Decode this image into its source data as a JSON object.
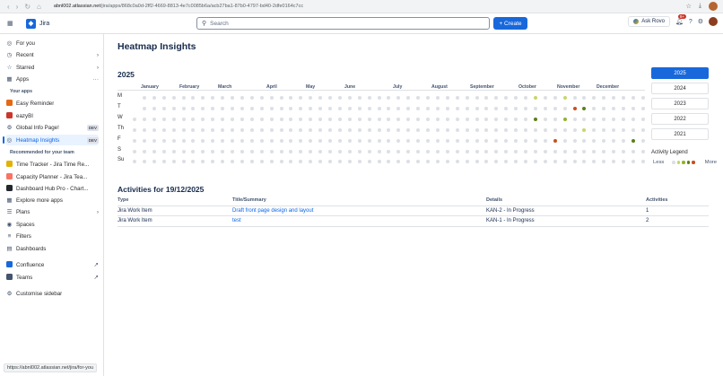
{
  "browser": {
    "nav_icons": [
      "back-icon",
      "forward-icon",
      "reload-icon",
      "home-icon"
    ],
    "url_domain": "abnl002.atlassian.net",
    "url_path": "/jira/apps/868c0a0d-2ff2-4669-8813-4e7c0085b6a/acb27ba1-87b0-4797-bd40-2dfe0164c7cc",
    "status_url": "https://abnl002.atlassian.net/jira/for-you"
  },
  "topnav": {
    "brand": "Jira",
    "search_placeholder": "Search",
    "create_label": "+ Create",
    "ask_rovo": "Ask Rovo",
    "notif_badge": "9+"
  },
  "sidebar": {
    "items": [
      {
        "label": "For you",
        "icon": "person-icon"
      },
      {
        "label": "Recent",
        "icon": "clock-icon"
      },
      {
        "label": "Starred",
        "icon": "star-icon"
      },
      {
        "label": "Apps",
        "icon": "apps-icon"
      }
    ],
    "your_apps_heading": "Your apps",
    "apps": [
      {
        "label": "Easy Reminder"
      },
      {
        "label": "eazyBI"
      },
      {
        "label": "Global Info Page!",
        "badge": "DEV"
      },
      {
        "label": "Heatmap Insights",
        "badge": "DEV"
      }
    ],
    "recommended_heading": "Recommended for your team",
    "recommended": [
      {
        "label": "Time Tracker - Jira Time Re..."
      },
      {
        "label": "Capacity Planner - Jira Tea..."
      },
      {
        "label": "Dashboard Hub Pro - Chart..."
      },
      {
        "label": "Explore more apps"
      }
    ],
    "bottom": [
      {
        "label": "Plans"
      },
      {
        "label": "Spaces"
      },
      {
        "label": "Filters"
      },
      {
        "label": "Dashboards"
      },
      {
        "label": "Confluence"
      },
      {
        "label": "Teams"
      },
      {
        "label": "Customise sidebar"
      }
    ]
  },
  "page": {
    "title": "Heatmap Insights",
    "year": "2025",
    "months": [
      "January",
      "February",
      "March",
      "April",
      "May",
      "June",
      "July",
      "August",
      "September",
      "October",
      "November",
      "December"
    ],
    "days": [
      "M",
      "T",
      "W",
      "Th",
      "F",
      "S",
      "Su"
    ],
    "years": [
      "2025",
      "2024",
      "2023",
      "2022",
      "2021"
    ],
    "selected_year": "2025",
    "legend_title": "Activity Legend",
    "legend_less": "Less",
    "legend_more": "More",
    "legend_colors": [
      "#dcdfe4",
      "#c6d66a",
      "#8fb42f",
      "#5b7f1a",
      "#c6501f"
    ]
  },
  "activities": {
    "title": "Activities for 19/12/2025",
    "columns": [
      "Type",
      "Title/Summary",
      "Details",
      "Activities"
    ],
    "rows": [
      {
        "type": "Jira Work Item",
        "title": "Draft front page design and layout",
        "details": "KAN-2 - In Progress",
        "count": "1"
      },
      {
        "type": "Jira Work Item",
        "title": "test",
        "details": "KAN-1 - In Progress",
        "count": "2"
      }
    ]
  }
}
